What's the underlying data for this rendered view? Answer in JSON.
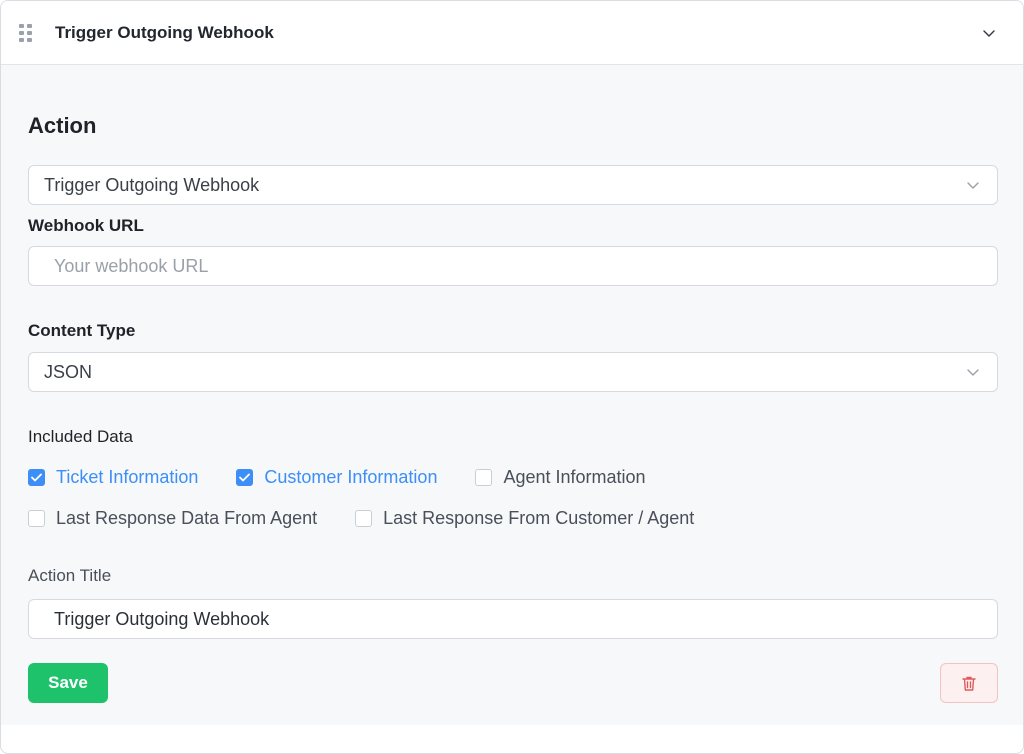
{
  "header": {
    "title": "Trigger Outgoing Webhook"
  },
  "action": {
    "heading": "Action",
    "selected": "Trigger Outgoing Webhook"
  },
  "webhook": {
    "label": "Webhook URL",
    "placeholder": "Your webhook URL",
    "value": ""
  },
  "content_type": {
    "label": "Content Type",
    "selected": "JSON"
  },
  "included_data": {
    "label": "Included Data",
    "options": [
      {
        "label": "Ticket Information",
        "checked": true
      },
      {
        "label": "Customer Information",
        "checked": true
      },
      {
        "label": "Agent Information",
        "checked": false
      },
      {
        "label": "Last Response Data From Agent",
        "checked": false
      },
      {
        "label": "Last Response From Customer / Agent",
        "checked": false
      }
    ]
  },
  "action_title": {
    "label": "Action Title",
    "value": "Trigger Outgoing Webhook"
  },
  "buttons": {
    "save": "Save"
  },
  "colors": {
    "accent": "#3d8ef7",
    "save": "#1ec26b",
    "danger": "#e05a5a"
  }
}
